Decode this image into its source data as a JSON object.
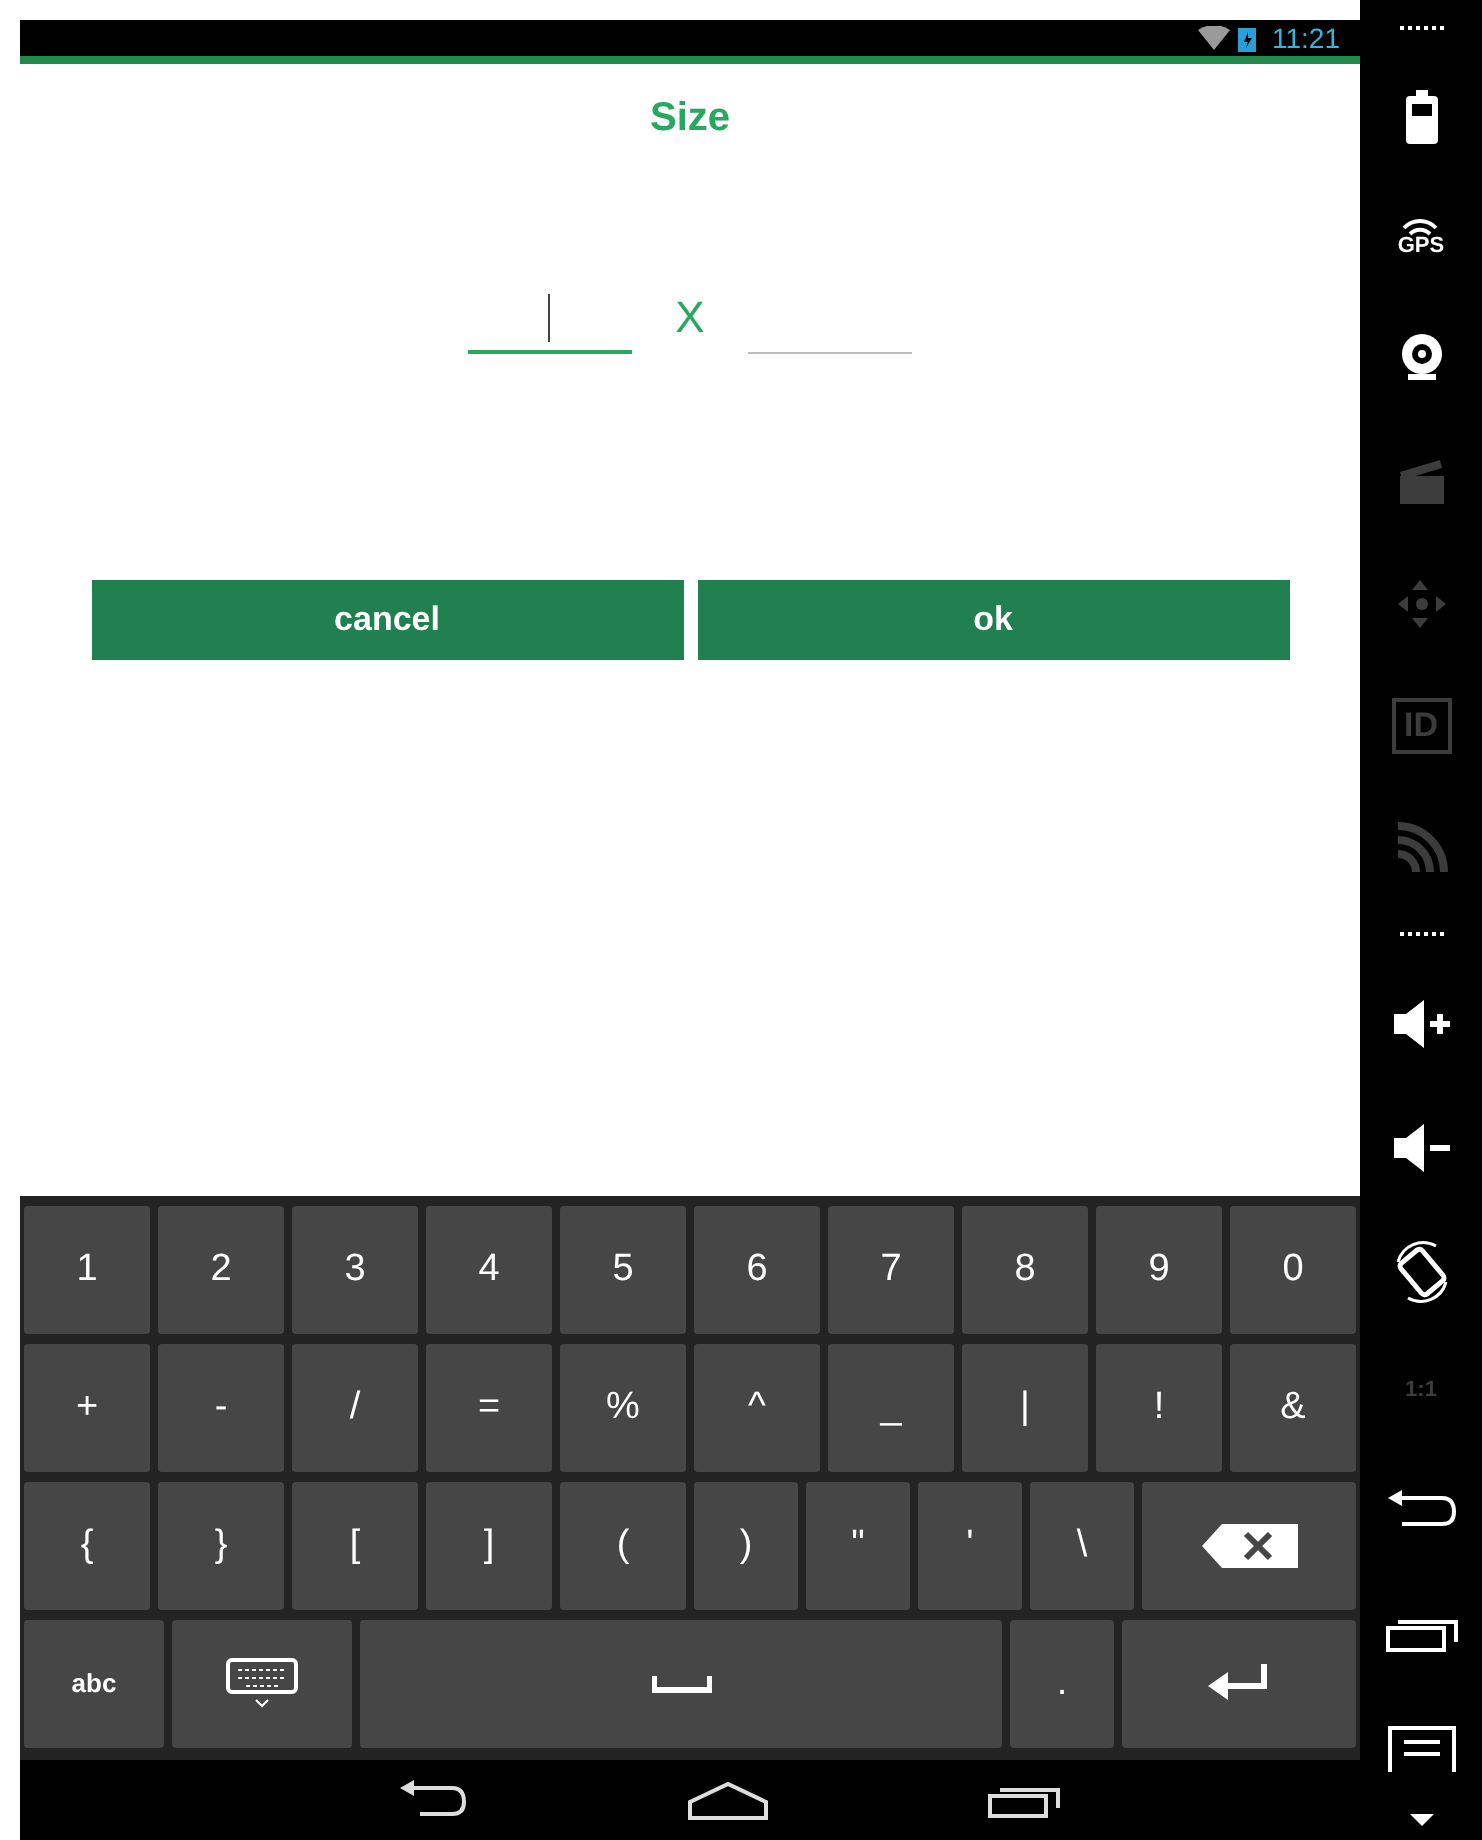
{
  "status_bar": {
    "time": "11:21"
  },
  "dialog": {
    "title": "Size",
    "fields": [
      {
        "focused": true
      },
      {
        "focused": false
      }
    ],
    "separator": "X",
    "buttons": [
      "cancel",
      "ok"
    ]
  },
  "keyboard": {
    "rows": [
      [
        {
          "kind": "char",
          "label": "1"
        },
        {
          "kind": "char",
          "label": "2"
        },
        {
          "kind": "char",
          "label": "3"
        },
        {
          "kind": "char",
          "label": "4"
        },
        {
          "kind": "char",
          "label": "5"
        },
        {
          "kind": "char",
          "label": "6"
        },
        {
          "kind": "char",
          "label": "7"
        },
        {
          "kind": "char",
          "label": "8"
        },
        {
          "kind": "char",
          "label": "9"
        },
        {
          "kind": "char",
          "label": "0"
        }
      ],
      [
        {
          "kind": "char",
          "label": "+"
        },
        {
          "kind": "char",
          "label": "-"
        },
        {
          "kind": "char",
          "label": "/"
        },
        {
          "kind": "char",
          "label": "="
        },
        {
          "kind": "char",
          "label": "%"
        },
        {
          "kind": "char",
          "label": "^"
        },
        {
          "kind": "char",
          "label": "_"
        },
        {
          "kind": "char",
          "label": "|"
        },
        {
          "kind": "char",
          "label": "!"
        },
        {
          "kind": "char",
          "label": "&"
        }
      ],
      [
        {
          "kind": "char",
          "label": "{"
        },
        {
          "kind": "char",
          "label": "}"
        },
        {
          "kind": "char",
          "label": "["
        },
        {
          "kind": "char",
          "label": "]"
        },
        {
          "kind": "char",
          "label": "("
        },
        {
          "kind": "narrow",
          "label": ")"
        },
        {
          "kind": "narrow",
          "label": "\""
        },
        {
          "kind": "narrow",
          "label": "'"
        },
        {
          "kind": "narrow",
          "label": "\\"
        },
        {
          "kind": "backspace"
        }
      ],
      [
        {
          "kind": "abc",
          "label": "abc"
        },
        {
          "kind": "hide"
        },
        {
          "kind": "space"
        },
        {
          "kind": "narrow",
          "label": "."
        },
        {
          "kind": "enter"
        }
      ]
    ]
  },
  "nav_bar": [
    {
      "kind": "back"
    },
    {
      "kind": "home"
    },
    {
      "kind": "recents"
    }
  ],
  "side_panel": [
    {
      "kind": "grip",
      "disabled": false
    },
    {
      "kind": "battery",
      "disabled": false
    },
    {
      "kind": "gps",
      "label": "GPS",
      "disabled": false
    },
    {
      "kind": "webcam",
      "disabled": false
    },
    {
      "kind": "clapper",
      "disabled": true
    },
    {
      "kind": "dpad",
      "disabled": true
    },
    {
      "kind": "id",
      "label": "ID",
      "disabled": true
    },
    {
      "kind": "rss",
      "disabled": true
    },
    {
      "kind": "grip",
      "disabled": false
    },
    {
      "kind": "volup",
      "disabled": false
    },
    {
      "kind": "voldown",
      "disabled": false
    },
    {
      "kind": "rotate",
      "disabled": false
    },
    {
      "kind": "scale",
      "label": "1:1",
      "disabled": true
    },
    {
      "kind": "back",
      "disabled": false
    },
    {
      "kind": "recents",
      "disabled": false
    },
    {
      "kind": "menu",
      "disabled": false
    },
    {
      "kind": "down",
      "disabled": false
    }
  ]
}
